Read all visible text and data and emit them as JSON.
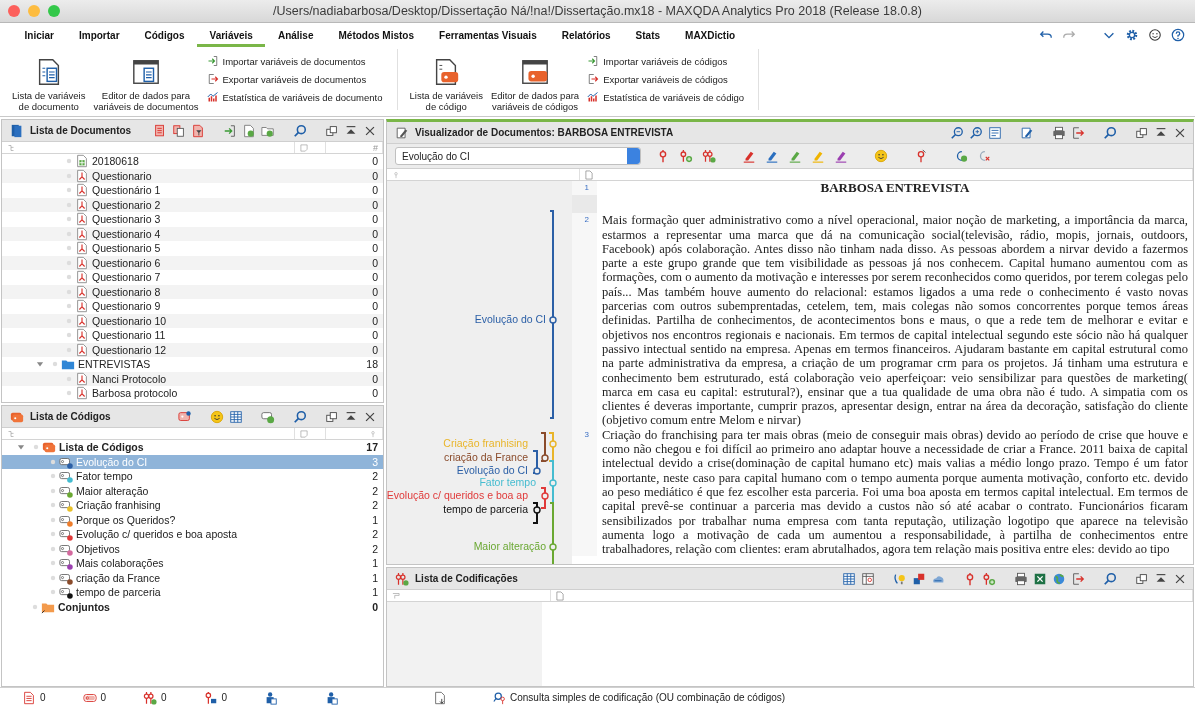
{
  "window": {
    "title": "/Users/nadiabarbosa/Desktop/Dissertação Ná/!na!/Dissertação.mx18 - MAXQDA Analytics Pro 2018  (Release 18.0.8)"
  },
  "menu_tabs": [
    {
      "label": "Iniciar",
      "selected": false
    },
    {
      "label": "Importar",
      "selected": false
    },
    {
      "label": "Códigos",
      "selected": false
    },
    {
      "label": "Variáveis",
      "selected": true
    },
    {
      "label": "Análise",
      "selected": false
    },
    {
      "label": "Métodos Mistos",
      "selected": false
    },
    {
      "label": "Ferramentas Visuais",
      "selected": false
    },
    {
      "label": "Relatórios",
      "selected": false
    },
    {
      "label": "Stats",
      "selected": false
    },
    {
      "label": "MAXDictio",
      "selected": false
    }
  ],
  "ribbon": {
    "groups": [
      {
        "kind": "document",
        "large_buttons": [
          "Lista de variáveis\nde documento",
          "Editor de dados para\nvariáveis de documentos"
        ],
        "small_buttons": [
          "Importar variáveis de documentos",
          "Exportar variáveis de documentos",
          "Estatística de variáveis de documento"
        ]
      },
      {
        "kind": "code",
        "large_buttons": [
          "Lista de variáveis\nde código",
          "Editor de dados para\nvariáveis de códigos"
        ],
        "small_buttons": [
          "Importar variáveis de códigos",
          "Exportar variáveis de códigos",
          "Estatística de variáveis de código"
        ]
      }
    ]
  },
  "document_list": {
    "title": "Lista de Documentos",
    "count_header": "#",
    "rows": [
      {
        "name": "20180618",
        "kind": "spreadsheet",
        "count": "0"
      },
      {
        "name": "Questionario",
        "kind": "pdf",
        "count": "0"
      },
      {
        "name": "Questionário 1",
        "kind": "pdf",
        "count": "0"
      },
      {
        "name": "Questionario 2",
        "kind": "pdf",
        "count": "0"
      },
      {
        "name": "Questionario 3",
        "kind": "pdf",
        "count": "0"
      },
      {
        "name": "Questionario 4",
        "kind": "pdf",
        "count": "0"
      },
      {
        "name": "Questionario 5",
        "kind": "pdf",
        "count": "0"
      },
      {
        "name": "Questionario 6",
        "kind": "pdf",
        "count": "0"
      },
      {
        "name": "Questionario 7",
        "kind": "pdf",
        "count": "0"
      },
      {
        "name": "Questionario 8",
        "kind": "pdf",
        "count": "0"
      },
      {
        "name": "Questionario 9",
        "kind": "pdf",
        "count": "0"
      },
      {
        "name": "Questionario 10",
        "kind": "pdf",
        "count": "0"
      },
      {
        "name": "Questionario 11",
        "kind": "pdf",
        "count": "0"
      },
      {
        "name": "Questionario 12",
        "kind": "pdf",
        "count": "0"
      },
      {
        "name": "ENTREVISTAS",
        "kind": "folder",
        "count": "18",
        "expanded": true,
        "children": [
          {
            "name": "Nanci Protocolo",
            "kind": "pdf",
            "count": "0"
          },
          {
            "name": "Barbosa protocolo",
            "kind": "pdf",
            "count": "0"
          }
        ]
      }
    ]
  },
  "code_list": {
    "title": "Lista de Códigos",
    "root": {
      "name": "Lista de Códigos",
      "count": "17",
      "expanded": true,
      "children": [
        {
          "name": "Evolução do CI",
          "count": "3",
          "color": "#2b5fa6",
          "selected": true
        },
        {
          "name": "Fator tempo",
          "count": "2",
          "color": "#45bcd0",
          "selected": false
        },
        {
          "name": "Maior alteração",
          "count": "2",
          "color": "#6aa832",
          "selected": false
        },
        {
          "name": "Criação franhising",
          "count": "2",
          "color": "#e9c12a",
          "selected": false
        },
        {
          "name": "Porque os Queridos?",
          "count": "1",
          "color": "#ee7d2b",
          "selected": false
        },
        {
          "name": "Evolução c/ queridos e boa aposta",
          "count": "2",
          "color": "#e03a3a",
          "selected": false
        },
        {
          "name": "Objetivos",
          "count": "2",
          "color": "#d4699e",
          "selected": false
        },
        {
          "name": "Mais colaborações",
          "count": "1",
          "color": "#9b3fb0",
          "selected": false
        },
        {
          "name": "criação da France",
          "count": "1",
          "color": "#8a4b2b",
          "selected": false
        },
        {
          "name": "tempo de parceria",
          "count": "1",
          "color": "#111111",
          "selected": false
        }
      ]
    },
    "sets": {
      "name": "Conjuntos",
      "count": "0"
    }
  },
  "viewer": {
    "title": "Visualizador de Documentos: BARBOSA ENTREVISTA",
    "code_filter": "Evolução do CI",
    "paragraphs": [
      {
        "kind": "heading",
        "number": "1",
        "text": "BARBOSA ENTREVISTA"
      },
      {
        "kind": "blank"
      },
      {
        "kind": "body",
        "number": "2",
        "text": "Mais formação quer administrativo como a nível operacional, maior noção de marketing, a importância da marca, estarmos a representar uma marca que dá na comunicação social(televisão, rádio, mopis, jornais, outdoors, Facebook) após colaboração. Antes disso não tinham nada disso. As pessoas abordem a nirvar devido a fazermos parte a este grupo grande que tem visibilidade as pessoas já nos conhecem. Capital humano aumentou com as formações, com o aumento da motivação e interesses por serem reconhecidos como queridos, por terem colegas pelo país... Mas também houve aumento do relacional: estamos ligados a uma rede o conhecimento é vasto novas parcerias com outros subemprentadas, cetelem, tem, mais colegas não somos concorrentes porque temos áreas definidas. Partilha de conhecimentos, de acontecimentos bons e maus, o que a rede tem de melhorar e evitar e objetivos nos encontros regionais e nacionais. Em termos de capital intelectual segundo este sócio não há qualquer passivo intectual sentido na empresa. Apenas em termos financeiros. Ajudaram bastante em capital estrutural como na parte administrativa da empresa, a criação de um programar crm para os projetos. Já tinham uma estrutura e conhecimento bem estruturado, está colaboração veio aperfeiçoar: veio sensibilizar para questões de marketing( marca em casa eu capital: estrutural?), ensinar que a tua qualidade de uma obra não é tudo. A simpatia com os clientes é deveras importante, cumprir prazos, apresentar design, entrar na área da decoração, satisfação do cliente (objetivo comum entre Melom e nirvar)"
      },
      {
        "kind": "body",
        "number": "3",
        "text": "Criação do franchising para ter mais obras (meio de conseguir mais obras) devido ao período de crise que houve e como não chegou e foi difícil ao primeiro ano adaptar houve a necessidade de criar a France. 2011 baixa de capital intelectual devido a crise(dominação de capital humano etc) mais valias a médio longo prazo. Tempo é um fator importante, neste caso para capital humano com o tempo aumenta porque aumenta motivação, conforto etc. devido ao peso mediático é que fez escolher esta parceria. Foi uma boa aposta em termos capital intelectual. Em termos de capital prevê-se continuar a parceria mas devido a custos não só até acabar o contrato. Funcionários ficaram sensibilizados por trabalhar numa empresa com tanta reputação, utilização logotipo que aparece na televisão aumenta logo a motivação de cada um aumentou a responsabilidade, à partilha de conhecimentos entre trabalhadores, relação com clientes: eram abrutalhados, agora tem relação mais positiva entre eles: devido ao tipo"
      }
    ],
    "margin_codings": [
      {
        "label": "Evolução do CI",
        "color": "#2b5fa6"
      },
      {
        "label": "Criação franhising",
        "color": "#e9b52a"
      },
      {
        "label": "criação da France",
        "color": "#8a4b2b"
      },
      {
        "label": "Evolução do CI",
        "color": "#2b5fa6"
      },
      {
        "label": "Fator tempo",
        "color": "#45bcd0"
      },
      {
        "label": "Evolução c/ queridos e boa ap",
        "color": "#e03a3a"
      },
      {
        "label": "tempo de parceria",
        "color": "#111111"
      },
      {
        "label": "Maior alteração",
        "color": "#6aa832"
      }
    ]
  },
  "codings_list": {
    "title": "Lista de Codificações"
  },
  "status_bar": {
    "counters": [
      "0",
      "0",
      "0",
      "0"
    ],
    "query": "Consulta simples de codificação (OU combinação de códigos)"
  }
}
